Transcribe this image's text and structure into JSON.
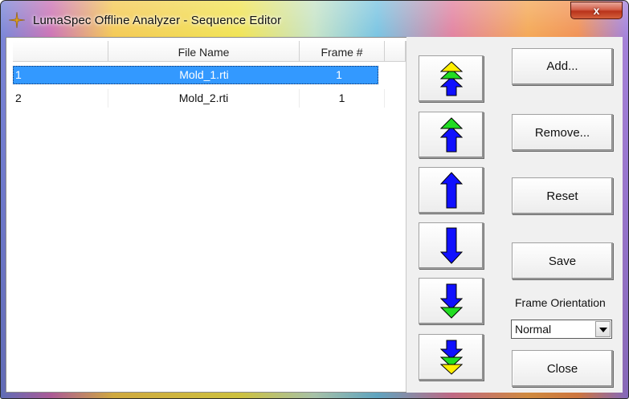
{
  "window": {
    "title": "LumaSpec Offline Analyzer - Sequence Editor",
    "close_label": "x"
  },
  "table": {
    "columns": [
      "",
      "File Name",
      "Frame #"
    ],
    "rows": [
      {
        "index": "1",
        "file": "Mold_1.rti",
        "frame": "1",
        "selected": true
      },
      {
        "index": "2",
        "file": "Mold_2.rti",
        "frame": "1",
        "selected": false
      }
    ]
  },
  "buttons": {
    "add": "Add...",
    "remove": "Remove...",
    "reset": "Reset",
    "save": "Save",
    "close": "Close"
  },
  "orientation": {
    "label": "Frame Orientation",
    "selected": "Normal"
  },
  "icons": {
    "move_top": "move-to-top-icon",
    "move_up_fast": "move-up-fast-icon",
    "move_up": "move-up-icon",
    "move_down": "move-down-icon",
    "move_down_fast": "move-down-fast-icon",
    "move_bottom": "move-to-bottom-icon"
  },
  "colors": {
    "selection": "#3399ff",
    "arrow_blue": "#1010ff",
    "arrow_green": "#22dd22",
    "arrow_yellow": "#ffee00"
  }
}
